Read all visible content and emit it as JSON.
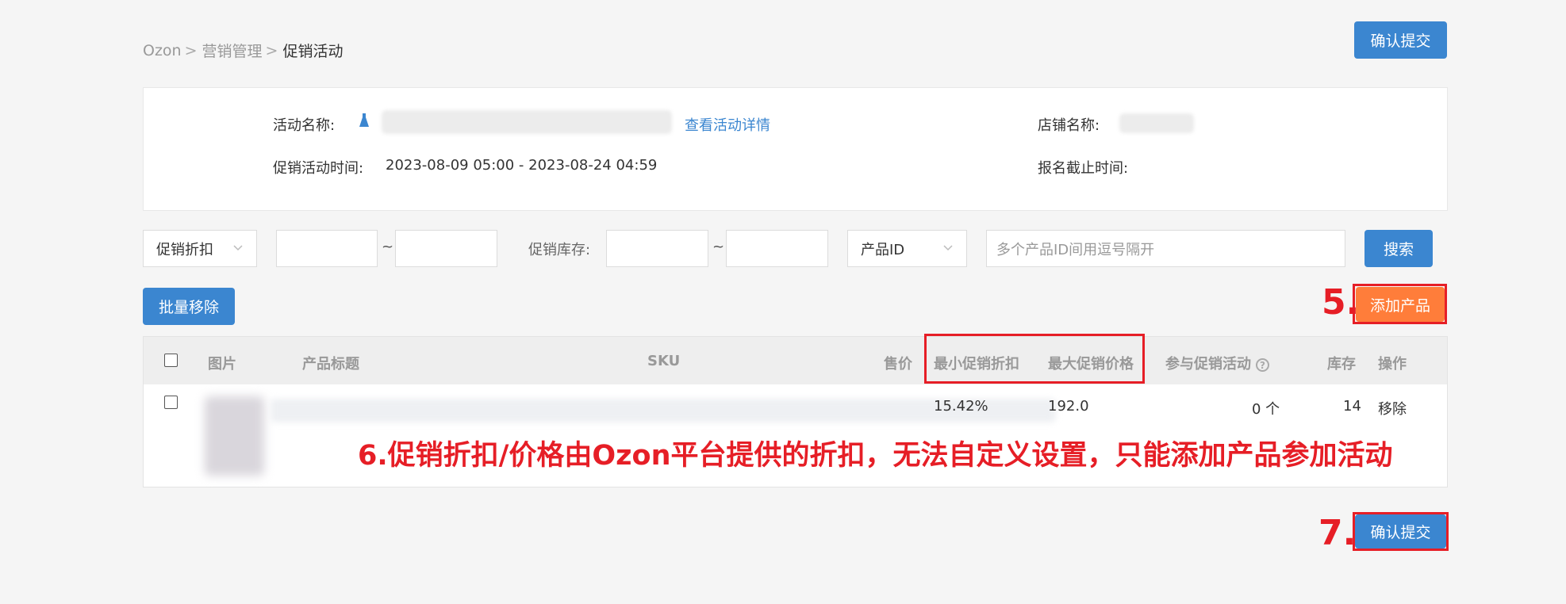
{
  "breadcrumb": {
    "items": [
      "Ozon",
      "营销管理",
      "促销活动"
    ],
    "separator": ">"
  },
  "header": {
    "submit_label": "确认提交"
  },
  "activity": {
    "name_label": "活动名称:",
    "detail_link": "查看活动详情",
    "time_label": "促销活动时间:",
    "time_value": "2023-08-09 05:00 - 2023-08-24 04:59",
    "store_label": "店铺名称:",
    "deadline_label": "报名截止时间:",
    "accent_color": "#3b86d0"
  },
  "filters": {
    "discount_select": "促销折扣",
    "range_separator": "~",
    "stock_label": "促销库存:",
    "product_id_select": "产品ID",
    "product_ids_placeholder": "多个产品ID间用逗号隔开",
    "search_label": "搜索"
  },
  "actions": {
    "batch_remove_label": "批量移除",
    "add_product_label": "添加产品"
  },
  "table": {
    "columns": [
      "图片",
      "产品标题",
      "SKU",
      "售价",
      "最小促销折扣",
      "最大促销价格",
      "参与促销活动",
      "库存",
      "操作"
    ],
    "rows": [
      {
        "min_discount": "15.42%",
        "max_price": "192.0",
        "activities": "0 个",
        "stock": "14",
        "action": "移除"
      }
    ]
  },
  "footer": {
    "submit_label": "确认提交"
  },
  "annotations": {
    "step5": "5.",
    "step6": "6.促销折扣/价格由Ozon平台提供的折扣，无法自定义设置，只能添加产品参加活动",
    "step7": "7.",
    "highlight_color": "#e61e26"
  }
}
